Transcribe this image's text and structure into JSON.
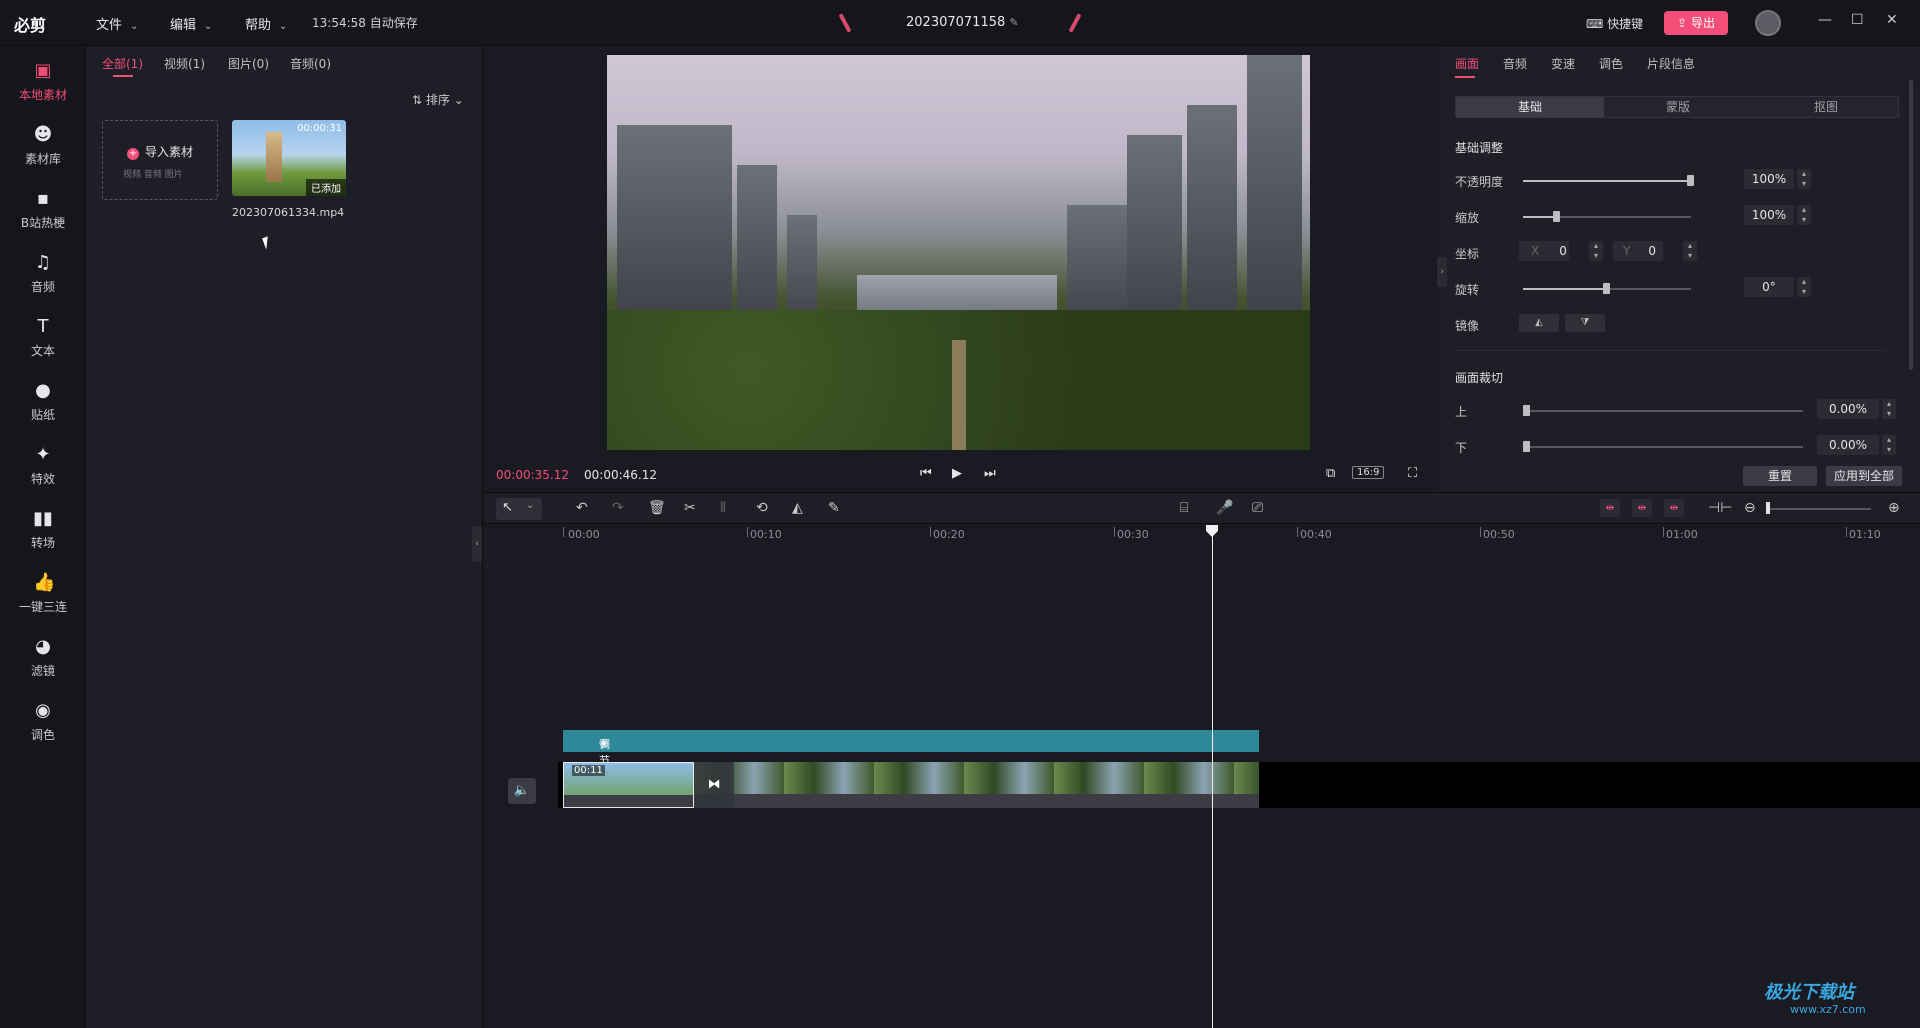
{
  "app": {
    "logo": "必剪",
    "menus": [
      "文件",
      "编辑",
      "帮助"
    ],
    "autosave": "13:54:58 自动保存",
    "project_name": "202307071158",
    "shortcut_label": "快捷键",
    "export_label": "导出"
  },
  "nav": [
    {
      "label": "本地素材",
      "icon": "folder-icon"
    },
    {
      "label": "素材库",
      "icon": "library-icon"
    },
    {
      "label": "B站热梗",
      "icon": "tv-icon"
    },
    {
      "label": "音频",
      "icon": "music-icon"
    },
    {
      "label": "文本",
      "icon": "text-icon"
    },
    {
      "label": "贴纸",
      "icon": "sticker-icon"
    },
    {
      "label": "特效",
      "icon": "effects-icon"
    },
    {
      "label": "转场",
      "icon": "transition-icon"
    },
    {
      "label": "一键三连",
      "icon": "thumbs-up-icon"
    },
    {
      "label": "滤镜",
      "icon": "filter-icon"
    },
    {
      "label": "调色",
      "icon": "palette-icon"
    }
  ],
  "media": {
    "tabs": [
      "全部(1)",
      "视频(1)",
      "图片(0)",
      "音频(0)"
    ],
    "sort_label": "排序",
    "import_label": "导入素材",
    "import_sub": "视频  音频  图片",
    "clip": {
      "duration": "00:00:31",
      "added": "已添加",
      "name": "202307061334.mp4"
    }
  },
  "preview": {
    "current_time": "00:00:35.12",
    "total_time": "00:00:46.12",
    "ratio": "16:9"
  },
  "props": {
    "tabs": [
      "画面",
      "音频",
      "变速",
      "调色",
      "片段信息"
    ],
    "subtabs": [
      "基础",
      "蒙版",
      "抠图"
    ],
    "section_basic": "基础调整",
    "opacity_label": "不透明度",
    "opacity_value": "100%",
    "opacity_level": 1.0,
    "scale_label": "缩放",
    "scale_value": "100%",
    "scale_level": 0.2,
    "position_label": "坐标",
    "x_label": "X",
    "x_value": "0",
    "y_label": "Y",
    "y_value": "0",
    "rotate_label": "旋转",
    "rotate_value": "0°",
    "rotate_level": 0.5,
    "mirror_label": "镜像",
    "section_crop": "画面裁切",
    "crop_top_label": "上",
    "crop_top_value": "0.00%",
    "crop_bottom_label": "下",
    "crop_bottom_value": "0.00%",
    "reset_label": "重置",
    "apply_all_label": "应用到全部"
  },
  "timeline": {
    "ticks": [
      "00:00",
      "00:10",
      "00:20",
      "00:30",
      "00:40",
      "00:50",
      "01:00",
      "01:10"
    ],
    "adjust_label": "调节",
    "clip1_tag": "00:11"
  },
  "watermark": {
    "name": "极光下载站",
    "url": "www.xz7.com"
  }
}
